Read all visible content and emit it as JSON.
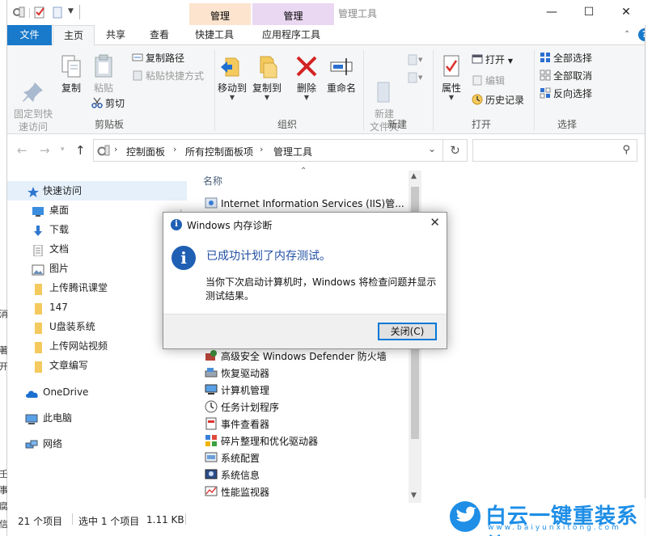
{
  "window": {
    "title": "管理工具",
    "context_tab_1": "管理",
    "context_tab_2": "管理"
  },
  "tabs": {
    "file": "文件",
    "home": "主页",
    "share": "共享",
    "view": "查看",
    "shortcut_tools": "快捷工具",
    "app_tools": "应用程序工具",
    "help": "?"
  },
  "ribbon": {
    "clipboard": {
      "label": "剪贴板",
      "pin_quick": "固定到快\n速访问",
      "copy": "复制",
      "paste": "粘贴",
      "copy_path": "复制路径",
      "paste_shortcut": "粘贴快捷方式",
      "cut": "剪切"
    },
    "organize": {
      "label": "组织",
      "move_to": "移动到",
      "copy_to": "复制到",
      "delete": "删除",
      "rename": "重命名"
    },
    "new": {
      "label": "新建",
      "new_folder": "新建\n文件夹"
    },
    "open": {
      "label": "打开",
      "properties": "属性",
      "open": "打开",
      "edit": "编辑",
      "history": "历史记录"
    },
    "select": {
      "label": "选择",
      "select_all": "全部选择",
      "select_none": "全部取消",
      "invert": "反向选择"
    }
  },
  "address": {
    "crumbs": [
      "控制面板",
      "所有控制面板项",
      "管理工具"
    ]
  },
  "nav": {
    "quick_access": "快速访问",
    "items": [
      "桌面",
      "下载",
      "文档",
      "图片",
      "上传腾讯课堂",
      "147",
      "U盘装系统",
      "上传网站视频",
      "文章编写"
    ],
    "onedrive": "OneDrive",
    "this_pc": "此电脑",
    "network": "网络"
  },
  "filelist": {
    "column_name": "名称",
    "top_item": "Internet Information Services (IIS)管...",
    "items": [
      "高级安全 Windows Defender 防火墙",
      "恢复驱动器",
      "计算机管理",
      "任务计划程序",
      "事件查看器",
      "碎片整理和优化驱动器",
      "系统配置",
      "系统信息",
      "性能监视器"
    ]
  },
  "status": {
    "count": "21 个项目",
    "selected": "选中 1 个项目",
    "size": "1.11 KB"
  },
  "dialog": {
    "title": "Windows 内存诊断",
    "headline": "已成功计划了内存测试。",
    "body": "当你下次启动计算机时，Windows 将检查问题并显示测试结果。",
    "close_button": "关闭(C)"
  },
  "background_window": {
    "chars": [
      "消",
      "著",
      "开",
      "壬",
      "事",
      "腐",
      "信"
    ]
  },
  "watermark": {
    "name": "白云一键重装系统",
    "url": "www.baiyunxitong.com"
  },
  "colors": {
    "accent": "#1979ca",
    "dialog_headline": "#1f4ea3",
    "ribbon_bg": "#f5f6f7"
  }
}
